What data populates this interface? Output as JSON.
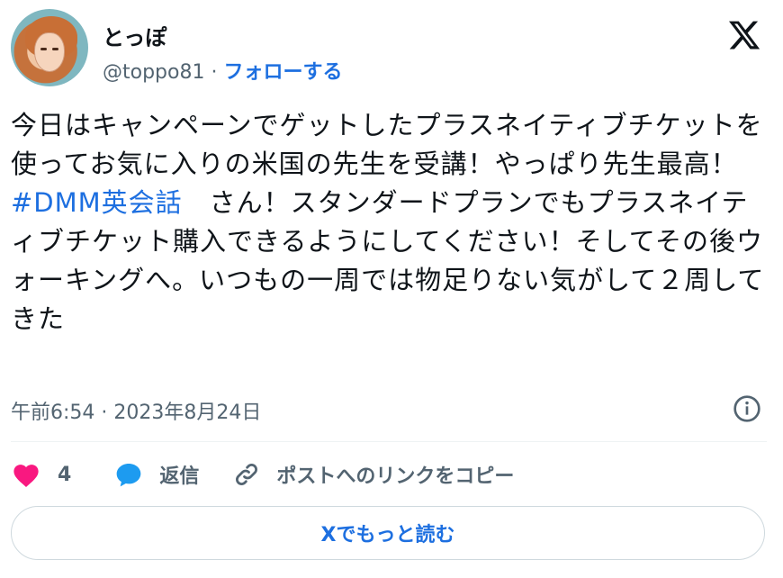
{
  "author": {
    "display_name": "とっぽ",
    "handle": "@toppo81",
    "separator": " · ",
    "follow_label": "フォローする"
  },
  "tweet": {
    "text_before_hashtag": "今日はキャンペーンでゲットしたプラスネイティブチケットを使ってお気に入りの米国の先生を受講！やっぱり先生最高！",
    "hashtag": "#DMM英会話",
    "text_after_hashtag": "　さん！スタンダードプランでもプラスネイティブチケット購入できるようにしてください！そしてその後ウォーキングへ。いつもの一周では物足りない気がして２周してきた"
  },
  "timestamp": "午前6:54 · 2023年8月24日",
  "actions": {
    "like_count": "4",
    "reply_label": "返信",
    "copy_link_label": "ポストへのリンクをコピー"
  },
  "read_more_label": "Xでもっと読む",
  "colors": {
    "like": "#f91880",
    "reply": "#1d9bf0",
    "link": "#1d6fe0"
  }
}
